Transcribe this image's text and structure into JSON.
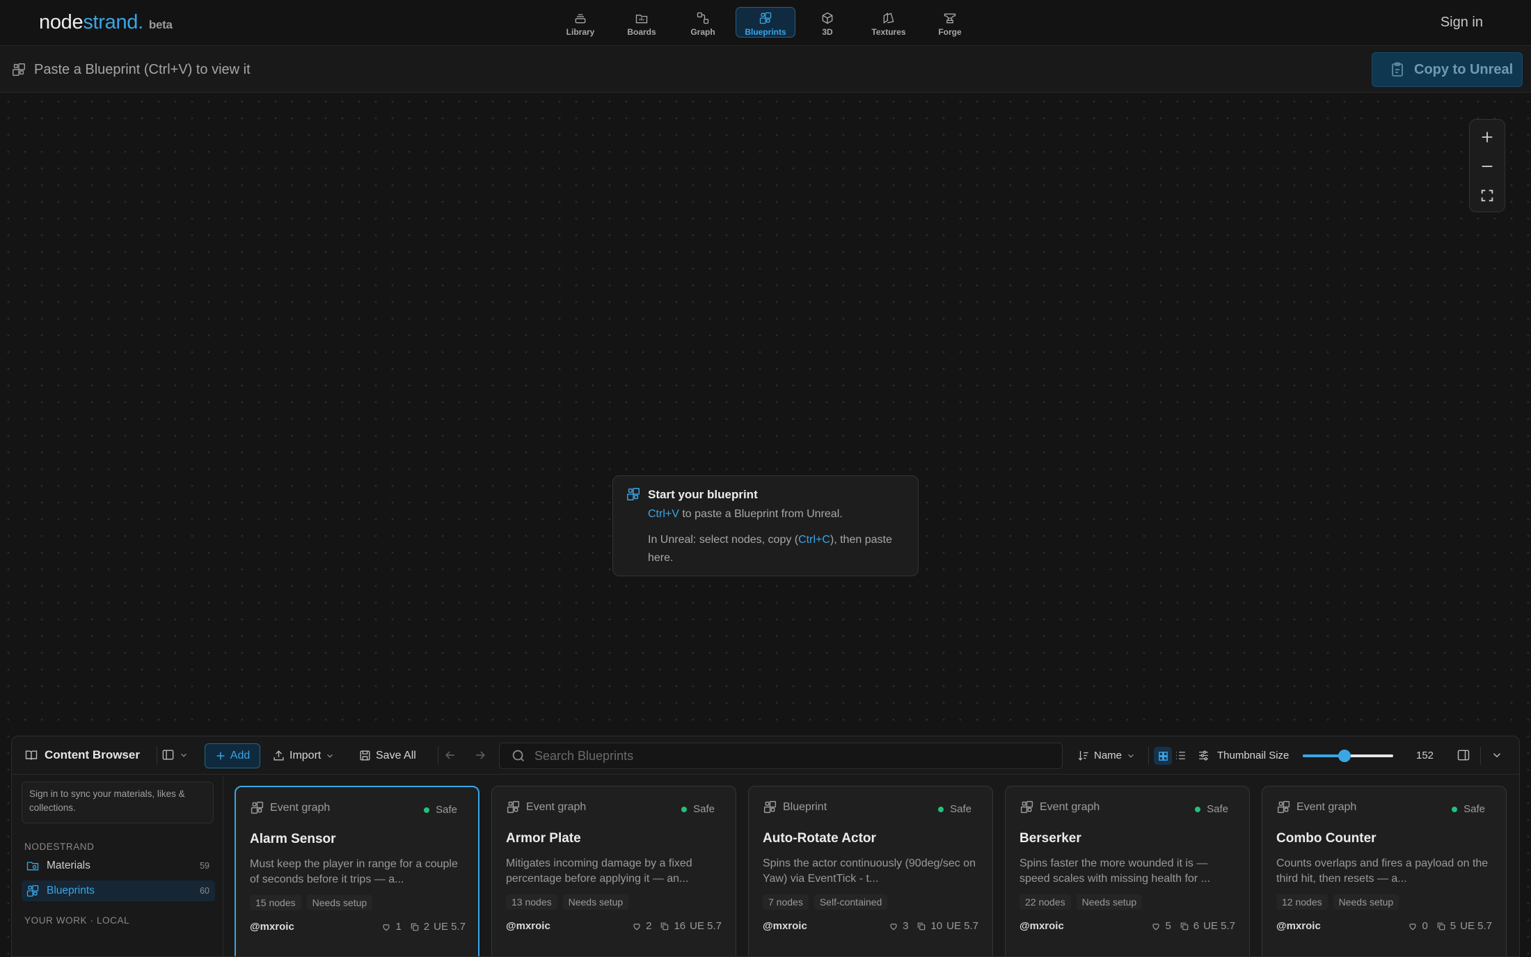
{
  "brand": {
    "name_part1": "node",
    "name_part2": "strand.",
    "badge": "beta"
  },
  "nav": {
    "tabs": [
      {
        "label": "Library",
        "icon": "library-icon"
      },
      {
        "label": "Boards",
        "icon": "boards-icon"
      },
      {
        "label": "Graph",
        "icon": "graph-icon"
      },
      {
        "label": "Blueprints",
        "icon": "blueprint-icon",
        "active": true
      },
      {
        "label": "3D",
        "icon": "cube-icon"
      },
      {
        "label": "Textures",
        "icon": "textures-icon"
      },
      {
        "label": "Forge",
        "icon": "anvil-icon"
      }
    ],
    "signin_label": "Sign in"
  },
  "pastebar": {
    "text": "Paste a Blueprint (Ctrl+V) to view it",
    "copy_label": "Copy to Unreal"
  },
  "hint": {
    "title": "Start your blueprint",
    "line1_key": "Ctrl+V",
    "line1_rest": " to paste a Blueprint from Unreal.",
    "line2_pre": "In Unreal: select nodes, copy (",
    "line2_key": "Ctrl+C",
    "line2_post": "), then paste here."
  },
  "content_browser": {
    "title": "Content Browser",
    "add_label": "Add",
    "import_label": "Import",
    "save_all_label": "Save All",
    "search_placeholder": "Search Blueprints",
    "sort_label": "Name",
    "thumb_label": "Thumbnail Size",
    "thumb_value": "152",
    "thumb_fraction": 0.46,
    "sidebar": {
      "signin_note": "Sign in to sync your materials, likes & collections.",
      "section1": "NODESTRAND",
      "items": [
        {
          "label": "Materials",
          "count": "59"
        },
        {
          "label": "Blueprints",
          "count": "60",
          "active": true
        }
      ],
      "section2": "YOUR WORK · LOCAL"
    },
    "cards": [
      {
        "type": "Event graph",
        "status": "Safe",
        "name": "Alarm Sensor",
        "desc": "Must keep the player in range for a couple of seconds before it trips — a...",
        "tags": [
          "15 nodes",
          "Needs setup"
        ],
        "author": "@mxroic",
        "likes": "1",
        "copies": "2",
        "version": "UE 5.7"
      },
      {
        "type": "Event graph",
        "status": "Safe",
        "name": "Armor Plate",
        "desc": "Mitigates incoming damage by a fixed percentage before applying it — an...",
        "tags": [
          "13 nodes",
          "Needs setup"
        ],
        "author": "@mxroic",
        "likes": "2",
        "copies": "16",
        "version": "UE 5.7"
      },
      {
        "type": "Blueprint",
        "status": "Safe",
        "name": "Auto-Rotate Actor",
        "desc": "Spins the actor continuously (90deg/sec on Yaw) via EventTick - t...",
        "tags": [
          "7 nodes",
          "Self-contained"
        ],
        "author": "@mxroic",
        "likes": "3",
        "copies": "10",
        "version": "UE 5.7"
      },
      {
        "type": "Event graph",
        "status": "Safe",
        "name": "Berserker",
        "desc": "Spins faster the more wounded it is — speed scales with missing health for ...",
        "tags": [
          "22 nodes",
          "Needs setup"
        ],
        "author": "@mxroic",
        "likes": "5",
        "copies": "6",
        "version": "UE 5.7"
      },
      {
        "type": "Event graph",
        "status": "Safe",
        "name": "Combo Counter",
        "desc": "Counts overlaps and fires a payload on the third hit, then resets — a...",
        "tags": [
          "12 nodes",
          "Needs setup"
        ],
        "author": "@mxroic",
        "likes": "0",
        "copies": "5",
        "version": "UE 5.7"
      }
    ]
  },
  "colors": {
    "accent": "#3aa6e6",
    "safe": "#22c17a",
    "background": "#141414"
  }
}
